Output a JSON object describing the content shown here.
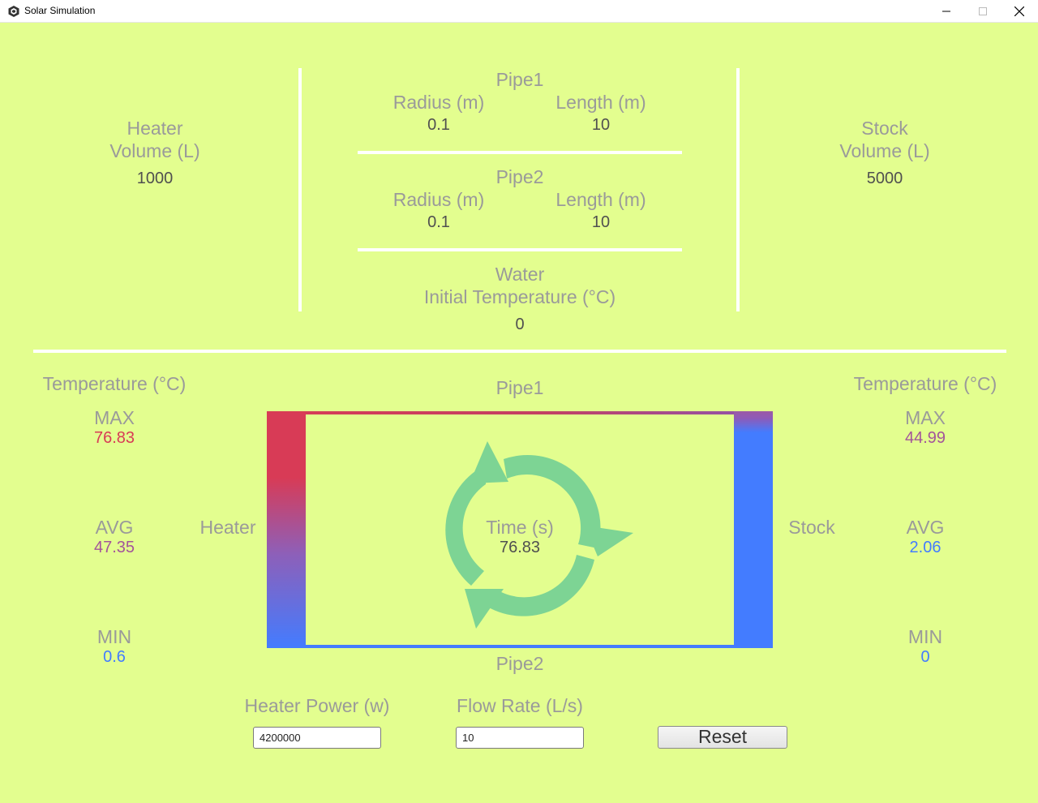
{
  "window": {
    "title": "Solar Simulation",
    "controls": {
      "minimize": "minimize-icon",
      "maximize": "maximize-icon",
      "close": "close-icon"
    }
  },
  "config": {
    "heater": {
      "line1": "Heater",
      "line2": "Volume (L)",
      "value": "1000"
    },
    "pipe1": {
      "title": "Pipe1",
      "radius_label": "Radius (m)",
      "radius": "0.1",
      "length_label": "Length (m)",
      "length": "10"
    },
    "pipe2": {
      "title": "Pipe2",
      "radius_label": "Radius (m)",
      "radius": "0.1",
      "length_label": "Length (m)",
      "length": "10"
    },
    "water": {
      "line1": "Water",
      "line2": "Initial Temperature (°C)",
      "value": "0"
    },
    "stock": {
      "line1": "Stock",
      "line2": "Volume (L)",
      "value": "5000"
    }
  },
  "heater_temp": {
    "title": "Temperature (°C)",
    "max_label": "MAX",
    "max": "76.83",
    "avg_label": "AVG",
    "avg": "47.35",
    "min_label": "MIN",
    "min": "0.6"
  },
  "stock_temp": {
    "title": "Temperature (°C)",
    "max_label": "MAX",
    "max": "44.99",
    "avg_label": "AVG",
    "avg": "2.06",
    "min_label": "MIN",
    "min": "0"
  },
  "diagram": {
    "pipe1_label": "Pipe1",
    "pipe2_label": "Pipe2",
    "heater_label": "Heater",
    "stock_label": "Stock",
    "time_label": "Time (s)",
    "time_value": "76.83",
    "cycle_icon": "recycle-cycle-icon"
  },
  "controls": {
    "heater_power_label": "Heater Power (w)",
    "heater_power_value": "4200000",
    "flow_rate_label": "Flow Rate (L/s)",
    "flow_rate_value": "10",
    "reset_label": "Reset"
  },
  "colors": {
    "background": "#e3fe8f",
    "hot": "#d83b56",
    "warm": "#a3559a",
    "cold": "#437cff",
    "cycle": "#7dd494"
  }
}
